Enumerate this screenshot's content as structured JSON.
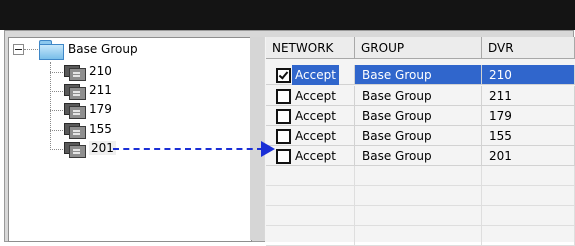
{
  "tree": {
    "root_label": "Base Group",
    "devices": [
      {
        "label": "210",
        "selected": false
      },
      {
        "label": "211",
        "selected": false
      },
      {
        "label": "179",
        "selected": false
      },
      {
        "label": "155",
        "selected": false
      },
      {
        "label": "201",
        "selected": true
      }
    ]
  },
  "grid": {
    "columns": [
      "NETWORK",
      "GROUP",
      "DVR"
    ],
    "rows": [
      {
        "network": "Accept",
        "checked": true,
        "group": "Base Group",
        "dvr": "210",
        "selected": true
      },
      {
        "network": "Accept",
        "checked": false,
        "group": "Base Group",
        "dvr": "211",
        "selected": false
      },
      {
        "network": "Accept",
        "checked": false,
        "group": "Base Group",
        "dvr": "179",
        "selected": false
      },
      {
        "network": "Accept",
        "checked": false,
        "group": "Base Group",
        "dvr": "155",
        "selected": false
      },
      {
        "network": "Accept",
        "checked": false,
        "group": "Base Group",
        "dvr": "201",
        "selected": false
      }
    ]
  },
  "colors": {
    "selection": "#3066cc",
    "arrow": "#1a2fd6",
    "titlebar": "#141414"
  }
}
